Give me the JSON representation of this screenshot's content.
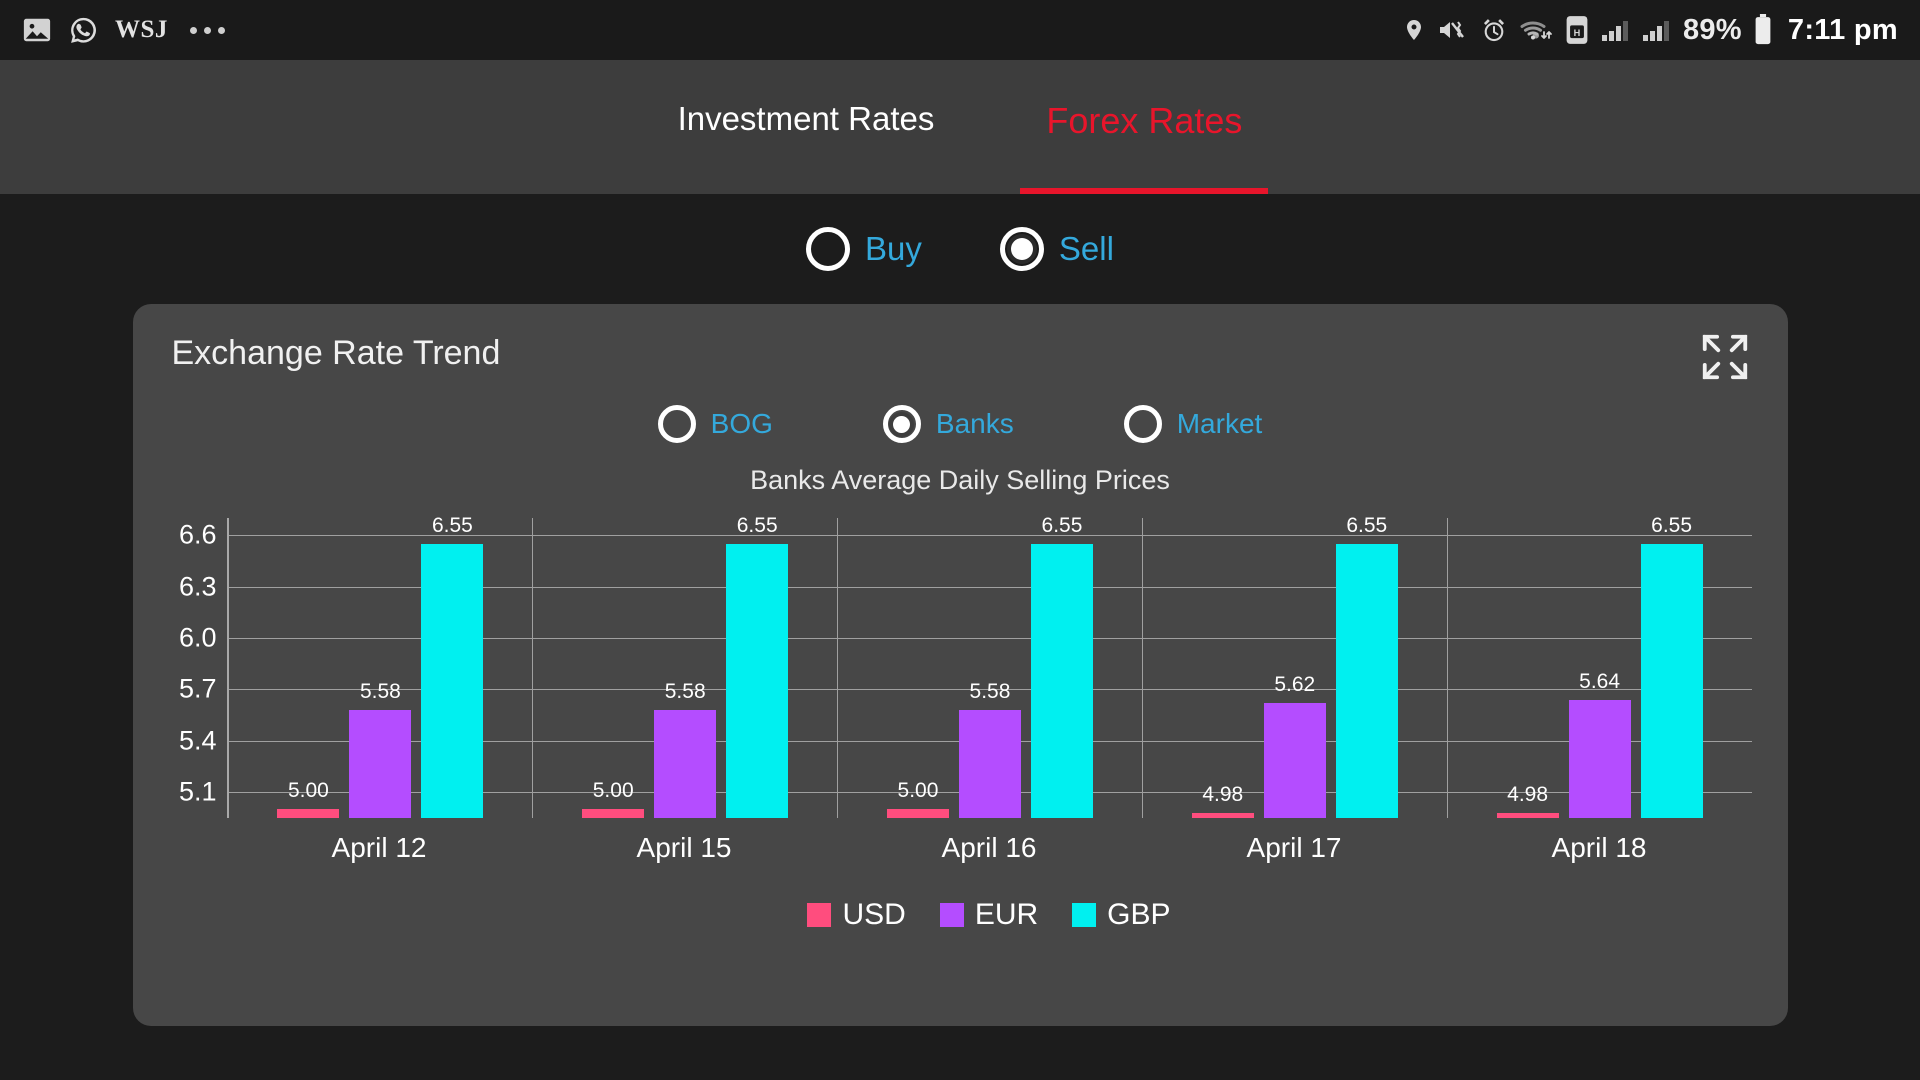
{
  "status_bar": {
    "left_icons": [
      "image-icon",
      "whatsapp-icon"
    ],
    "brand": "WSJ",
    "overflow": "•••",
    "right_icons": [
      "location-icon",
      "mute-vibrate-icon",
      "alarm-icon",
      "wifi-icon",
      "sim-card-icon",
      "signal-icon-1",
      "signal-icon-2"
    ],
    "battery": "89%",
    "time": "7:11 pm"
  },
  "tabs": [
    {
      "label": "Investment Rates",
      "active": false
    },
    {
      "label": "Forex Rates",
      "active": true
    }
  ],
  "direction_options": [
    {
      "label": "Buy",
      "selected": false
    },
    {
      "label": "Sell",
      "selected": true
    }
  ],
  "card": {
    "title": "Exchange Rate Trend",
    "expand_icon": "expand-fullscreen-icon",
    "source_options": [
      {
        "label": "BOG",
        "selected": false
      },
      {
        "label": "Banks",
        "selected": true
      },
      {
        "label": "Market",
        "selected": false
      }
    ],
    "subtitle": "Banks Average Daily Selling Prices"
  },
  "colors": {
    "accent_red": "#e8152b",
    "link_blue": "#34a9dc",
    "usd": "#ff4d7e",
    "eur": "#b44dff",
    "gbp": "#00f0f0",
    "card_bg": "#474747",
    "page_bg": "#1c1c1c",
    "tabbar_bg": "#3d3d3d"
  },
  "chart_data": {
    "type": "bar",
    "title": "Banks Average Daily Selling Prices",
    "xlabel": "",
    "ylabel": "",
    "categories": [
      "April 12",
      "April 15",
      "April 16",
      "April 17",
      "April 18"
    ],
    "yticks": [
      "6.6",
      "6.3",
      "6.0",
      "5.7",
      "5.4",
      "5.1"
    ],
    "ylim": [
      4.95,
      6.7
    ],
    "grid": true,
    "legend_position": "bottom",
    "series": [
      {
        "name": "USD",
        "color": "#ff4d7e",
        "values": [
          5.0,
          5.0,
          5.0,
          4.98,
          4.98
        ],
        "labels": [
          "5.00",
          "5.00",
          "5.00",
          "4.98",
          "4.98"
        ]
      },
      {
        "name": "EUR",
        "color": "#b44dff",
        "values": [
          5.58,
          5.58,
          5.58,
          5.62,
          5.64
        ],
        "labels": [
          "5.58",
          "5.58",
          "5.58",
          "5.62",
          "5.64"
        ]
      },
      {
        "name": "GBP",
        "color": "#00f0f0",
        "values": [
          6.55,
          6.55,
          6.55,
          6.55,
          6.55
        ],
        "labels": [
          "6.55",
          "6.55",
          "6.55",
          "6.55",
          "6.55"
        ]
      }
    ]
  }
}
